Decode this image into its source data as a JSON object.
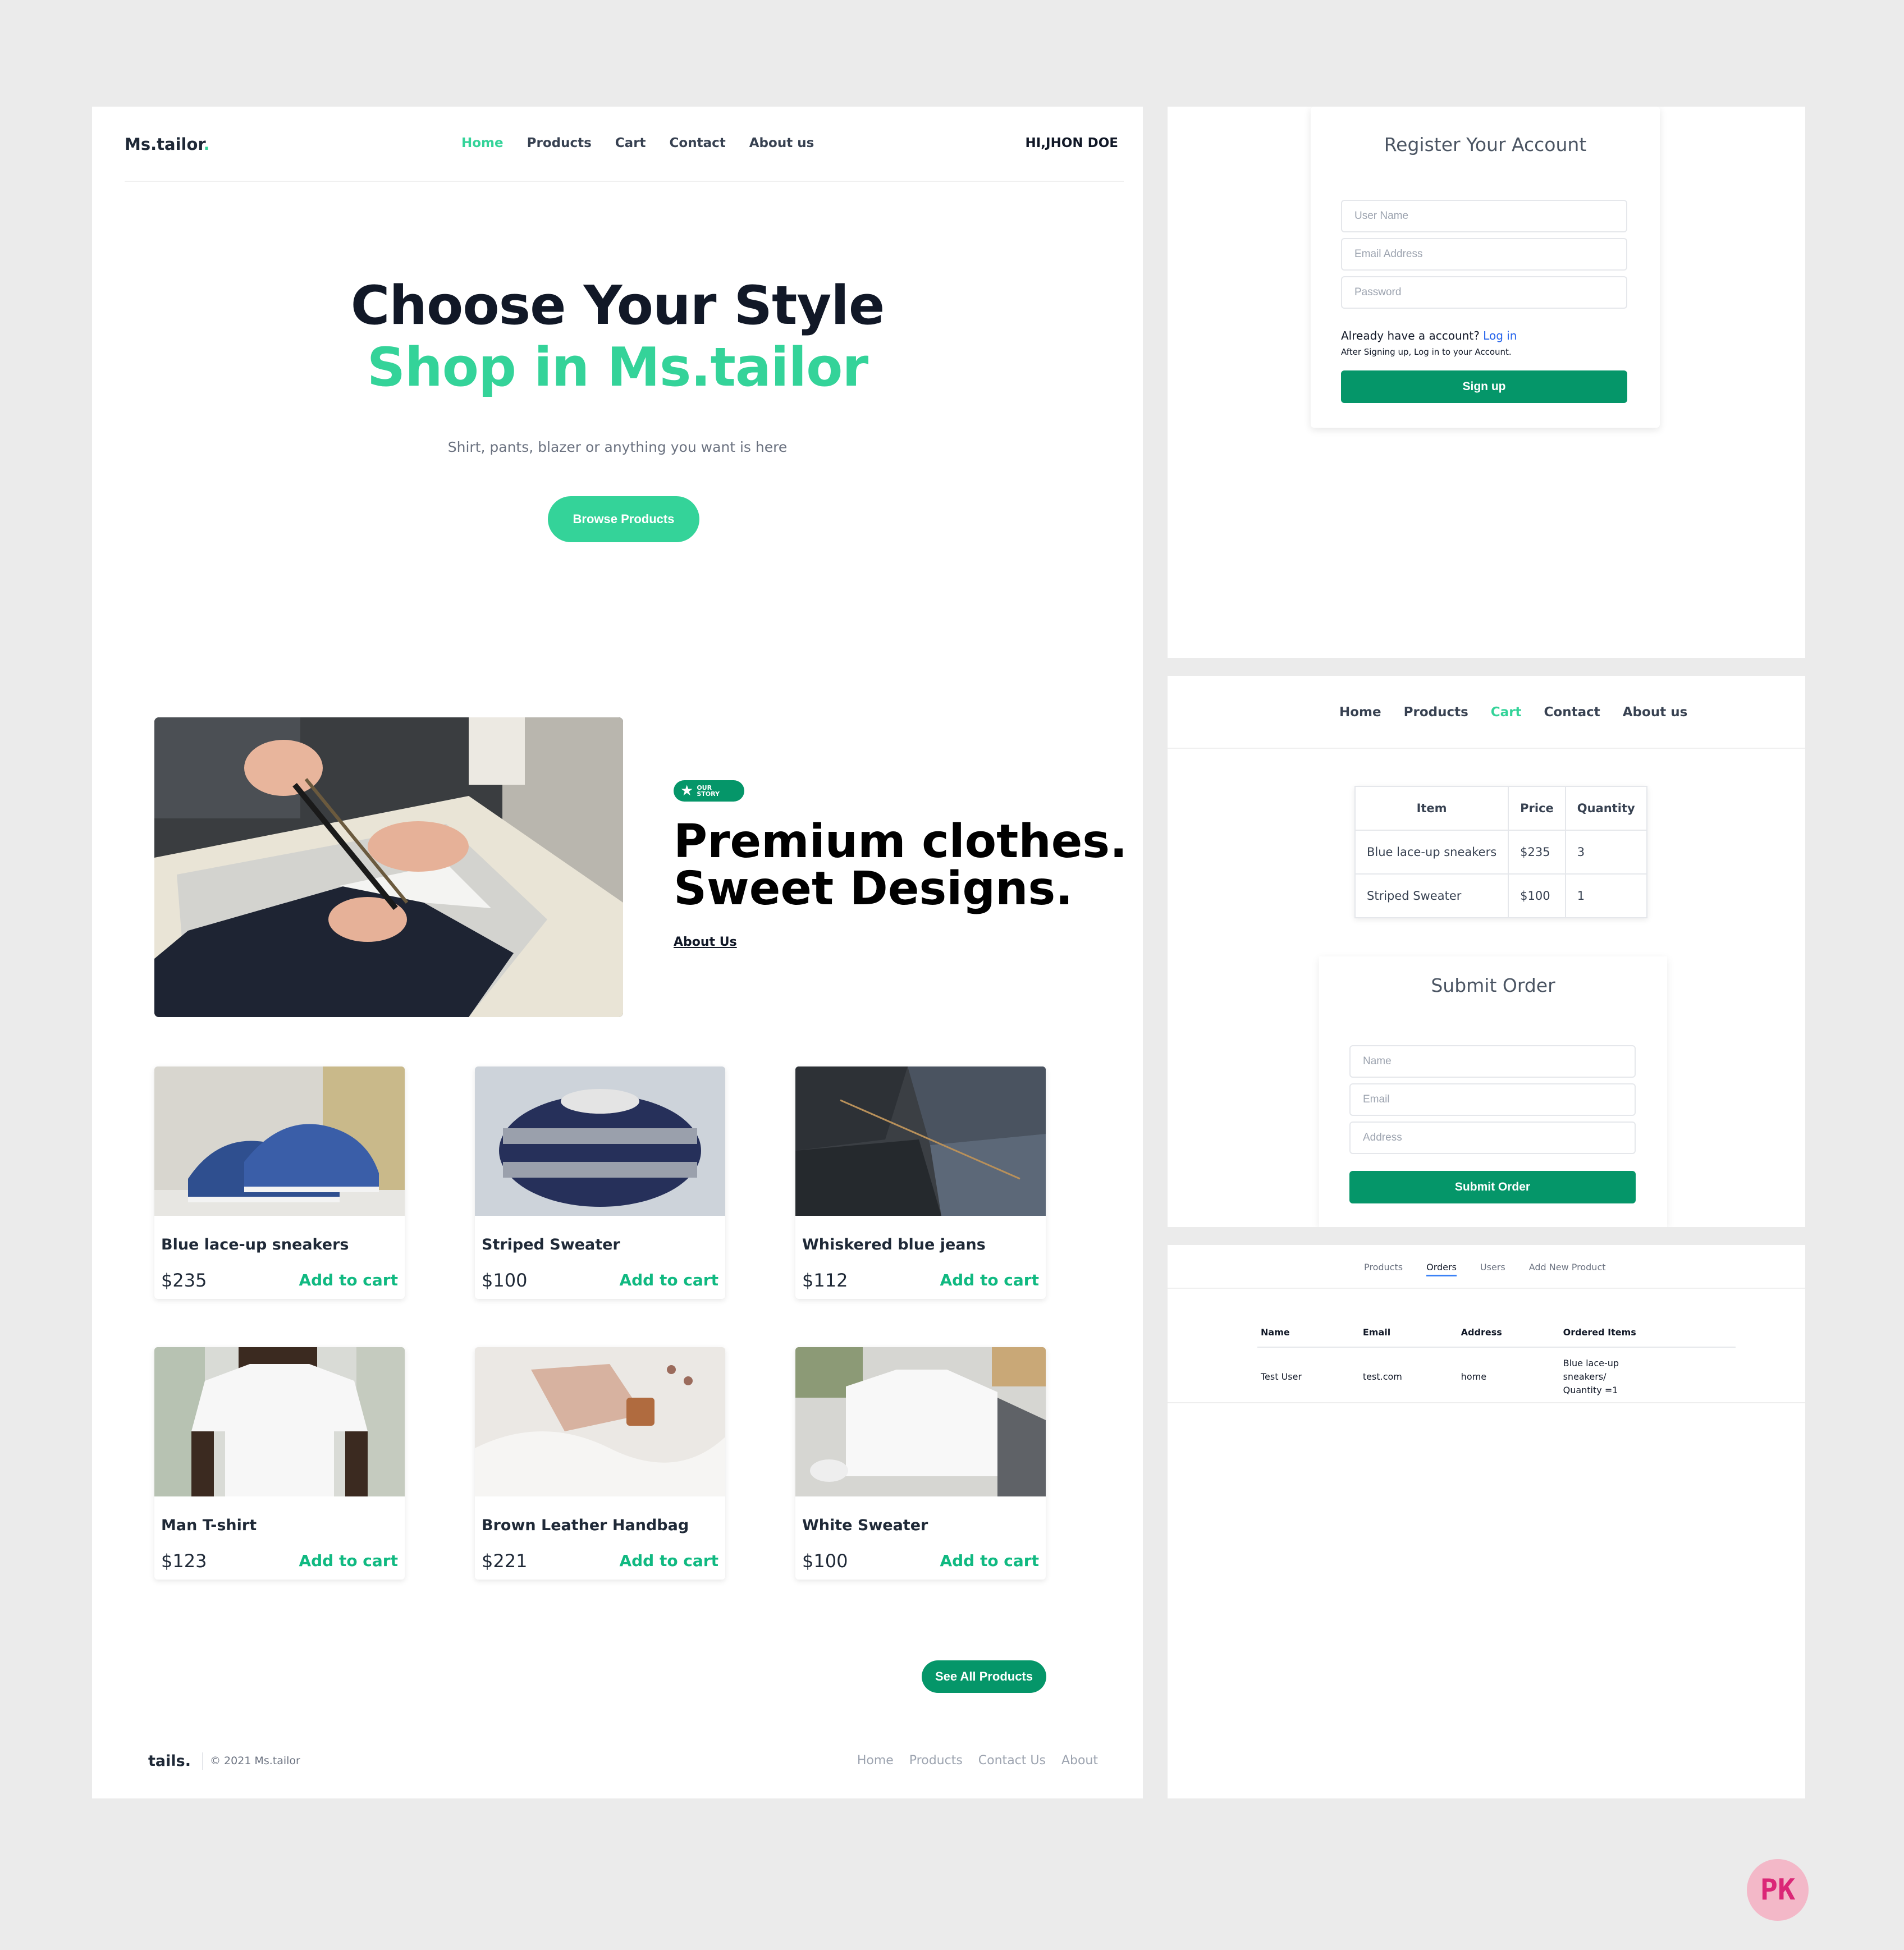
{
  "home": {
    "logo": "Ms.tailor",
    "logo_dot": ".",
    "nav": [
      "Home",
      "Products",
      "Cart",
      "Contact",
      "About us"
    ],
    "active_nav": "Home",
    "greeting": "HI,JHON DOE",
    "hero": {
      "title_line1": "Choose Your Style",
      "title_line2": "Shop in Ms.tailor",
      "subtitle": "Shirt, pants, blazer or anything you want is here",
      "cta": "Browse Products"
    },
    "story": {
      "badge": "OUR STORY",
      "badge_line1": "OUR",
      "badge_line2": "STORY",
      "heading_line1": "Premium clothes.",
      "heading_line2": "Sweet Designs.",
      "link": "About Us"
    },
    "products": [
      {
        "name": "Blue lace-up sneakers",
        "price": "$235",
        "action": "Add to cart"
      },
      {
        "name": "Striped Sweater",
        "price": "$100",
        "action": "Add to cart"
      },
      {
        "name": "Whiskered blue jeans",
        "price": "$112",
        "action": "Add to cart"
      },
      {
        "name": "Man T-shirt",
        "price": "$123",
        "action": "Add to cart"
      },
      {
        "name": "Brown Leather Handbag",
        "price": "$221",
        "action": "Add to cart"
      },
      {
        "name": "White Sweater",
        "price": "$100",
        "action": "Add to cart"
      }
    ],
    "see_all": "See All Products",
    "footer": {
      "logo": "tails.",
      "copyright": "© 2021 Ms.tailor",
      "links": [
        "Home",
        "Products",
        "Contact Us",
        "About"
      ]
    }
  },
  "register": {
    "title": "Register Your Account",
    "username_placeholder": "User Name",
    "email_placeholder": "Email Address",
    "password_placeholder": "Password",
    "already": "Already have a account?",
    "login_link": "Log in",
    "after_note": "After Signing up, Log in to your Account.",
    "submit": "Sign up"
  },
  "cart": {
    "nav": [
      "Home",
      "Products",
      "Cart",
      "Contact",
      "About us"
    ],
    "active_nav": "Cart",
    "columns": [
      "Item",
      "Price",
      "Quantity"
    ],
    "rows": [
      {
        "item": "Blue lace-up sneakers",
        "price": "$235",
        "quantity": "3"
      },
      {
        "item": "Striped Sweater",
        "price": "$100",
        "quantity": "1"
      }
    ],
    "order_form": {
      "title": "Submit Order",
      "name_placeholder": "Name",
      "email_placeholder": "Email",
      "address_placeholder": "Address",
      "submit": "Submit Order"
    }
  },
  "admin": {
    "tabs": [
      "Products",
      "Orders",
      "Users",
      "Add New Product"
    ],
    "active_tab": "Orders",
    "columns": [
      "Name",
      "Email",
      "Address",
      "Ordered Items"
    ],
    "rows": [
      {
        "name": "Test User",
        "email": "test.com",
        "address": "home",
        "items_line1": "Blue lace-up",
        "items_line2": "sneakers/",
        "items_line3": "Quantity =1"
      }
    ]
  },
  "watermark": "PK",
  "colors": {
    "accent": "#34d399",
    "primary_button": "#059669",
    "link_blue": "#2563eb",
    "page_bg": "#ebebeb"
  }
}
